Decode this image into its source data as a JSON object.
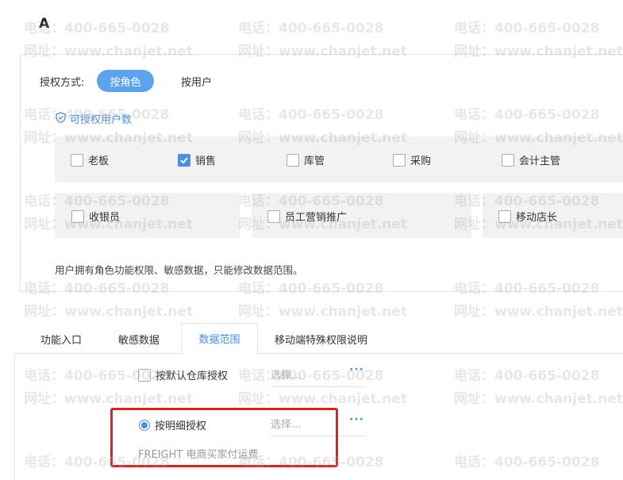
{
  "section_title": "A",
  "auth_mode": {
    "label": "授权方式:",
    "options": [
      "按角色",
      "按用户"
    ],
    "selected": "按角色"
  },
  "quota_link": "可授权用户数",
  "roles": [
    {
      "name": "老板",
      "checked": false
    },
    {
      "name": "销售",
      "checked": true
    },
    {
      "name": "库管",
      "checked": false
    },
    {
      "name": "采购",
      "checked": false
    },
    {
      "name": "会计主管",
      "checked": false
    },
    {
      "name": "收银员",
      "checked": false
    },
    {
      "name": "员工营销推广",
      "checked": false
    },
    {
      "name": "移动店长",
      "checked": false
    }
  ],
  "role_note": "用户拥有角色功能权限、敏感数据，只能修改数据范围。",
  "tabs": [
    "功能入口",
    "敏感数据",
    "数据范围",
    "移动端特殊权限说明"
  ],
  "active_tab": "数据范围",
  "data_scope": {
    "warehouse_label": "按默认仓库授权",
    "warehouse_placeholder": "选择...",
    "detail_label": "按明细授权",
    "detail_placeholder": "选择...",
    "more_label": "···",
    "freight_text": "FREIGHT 电商买家付运费"
  },
  "watermark": {
    "phone": "电话：400-665-0028",
    "site": "网址：www.chanjet.net"
  },
  "colors": {
    "accent": "#4a90e2",
    "pill": "#5ca3ee",
    "highlight_box": "#e0201e"
  }
}
